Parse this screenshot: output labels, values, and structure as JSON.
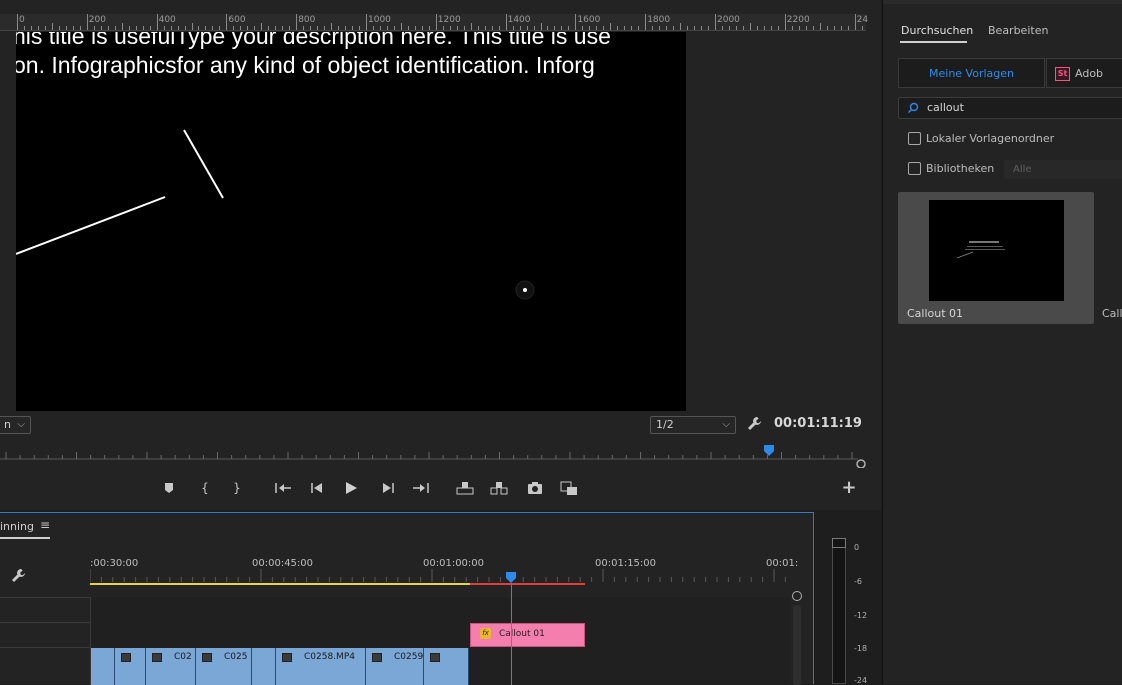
{
  "monitor": {
    "ruler_labels": [
      "0",
      "200",
      "400",
      "600",
      "800",
      "1000",
      "1200",
      "1400",
      "1600",
      "1800",
      "2000",
      "2200",
      "24"
    ],
    "video_text_line1": "his title is usefulType your description here. This title is use",
    "video_text_line2": "on. Infographicsfor any kind of object identification. Inforg",
    "zoom_value": "n",
    "resolution_value": "1/2",
    "timecode": "00:01:11:19"
  },
  "transport_icons": [
    "add-marker-icon",
    "mark-in-icon",
    "mark-out-icon",
    "go-to-in-icon",
    "step-back-icon",
    "play-icon",
    "step-forward-icon",
    "go-to-out-icon",
    "lift-icon",
    "extract-icon",
    "export-frame-icon",
    "comparison-view-icon",
    "add-button-icon"
  ],
  "essential_graphics": {
    "tabs": [
      "Durchsuchen",
      "Bearbeiten"
    ],
    "active_tab": "Durchsuchen",
    "source_buttons": [
      "Meine Vorlagen",
      "Adob"
    ],
    "stock_badge": "St",
    "search_value": "callout",
    "local_folder_label": "Lokaler Vorlagenordner",
    "libraries_label": "Bibliotheken",
    "libraries_dropdown": "Alle",
    "templates": [
      "Callout 01",
      "Callo"
    ],
    "accent_color": "#2d8ceb"
  },
  "timeline": {
    "sequence_name": "inning",
    "time_labels": [
      ":00:30:00",
      "00:00:45:00",
      "00:01:00:00",
      "00:01:15:00",
      "00:01:"
    ],
    "graphic_clip_label": "Callout 01",
    "video_clips": [
      "",
      "",
      "C02",
      "C025",
      "",
      "C0258.MP4",
      "C0259",
      ""
    ],
    "clip_color": "#7aa7d6",
    "graphic_clip_color": "#f47fae"
  },
  "meter": {
    "labels": [
      "0",
      "-6",
      "-12",
      "-18",
      "-24"
    ]
  }
}
